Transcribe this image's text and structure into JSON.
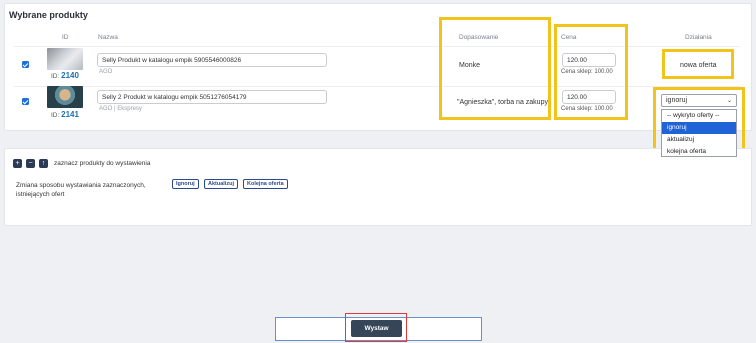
{
  "panel": {
    "title": "Wybrane produkty",
    "columns": {
      "id": "ID",
      "name": "Nazwa",
      "match": "Dopasowanie",
      "price": "Cena",
      "actions": "Działania"
    }
  },
  "rows": [
    {
      "id_prefix": "ID:",
      "id": "2140",
      "name": "Selly Produkt w katalogu empik 5905546000826",
      "sub": "AGO",
      "match": "Monke",
      "price": "120.00",
      "shop_price": "Cena sklep: 100.00",
      "action": "nowa oferta"
    },
    {
      "id_prefix": "ID:",
      "id": "2141",
      "name": "Selly 2 Produkt w katalogu empik 5051276054179",
      "sub": "AGO | Ekspresy",
      "match": "\"Agnieszka\", torba na zakupy",
      "price": "120.00",
      "shop_price": "Cena sklep: 100.00",
      "action_select": "ignoruj",
      "options": [
        "-- wykryto oferty --",
        "ignoruj",
        "aktualizuj",
        "kolejna oferta"
      ],
      "selected_option": "ignoruj"
    }
  ],
  "controls": {
    "mark_label": "zaznacz produkty do wystawienia",
    "change_label": "Zmiana sposobu wystawiania zaznaczonych, istniejących ofert",
    "btn_ignore": "Ignoruj",
    "btn_update": "Aktualizuj",
    "btn_next": "Kolejna oferta"
  },
  "footer": {
    "submit": "Wystaw"
  },
  "colors": {
    "highlight": "#f2c31b",
    "accent": "#1f63d6",
    "button": "#364558"
  }
}
